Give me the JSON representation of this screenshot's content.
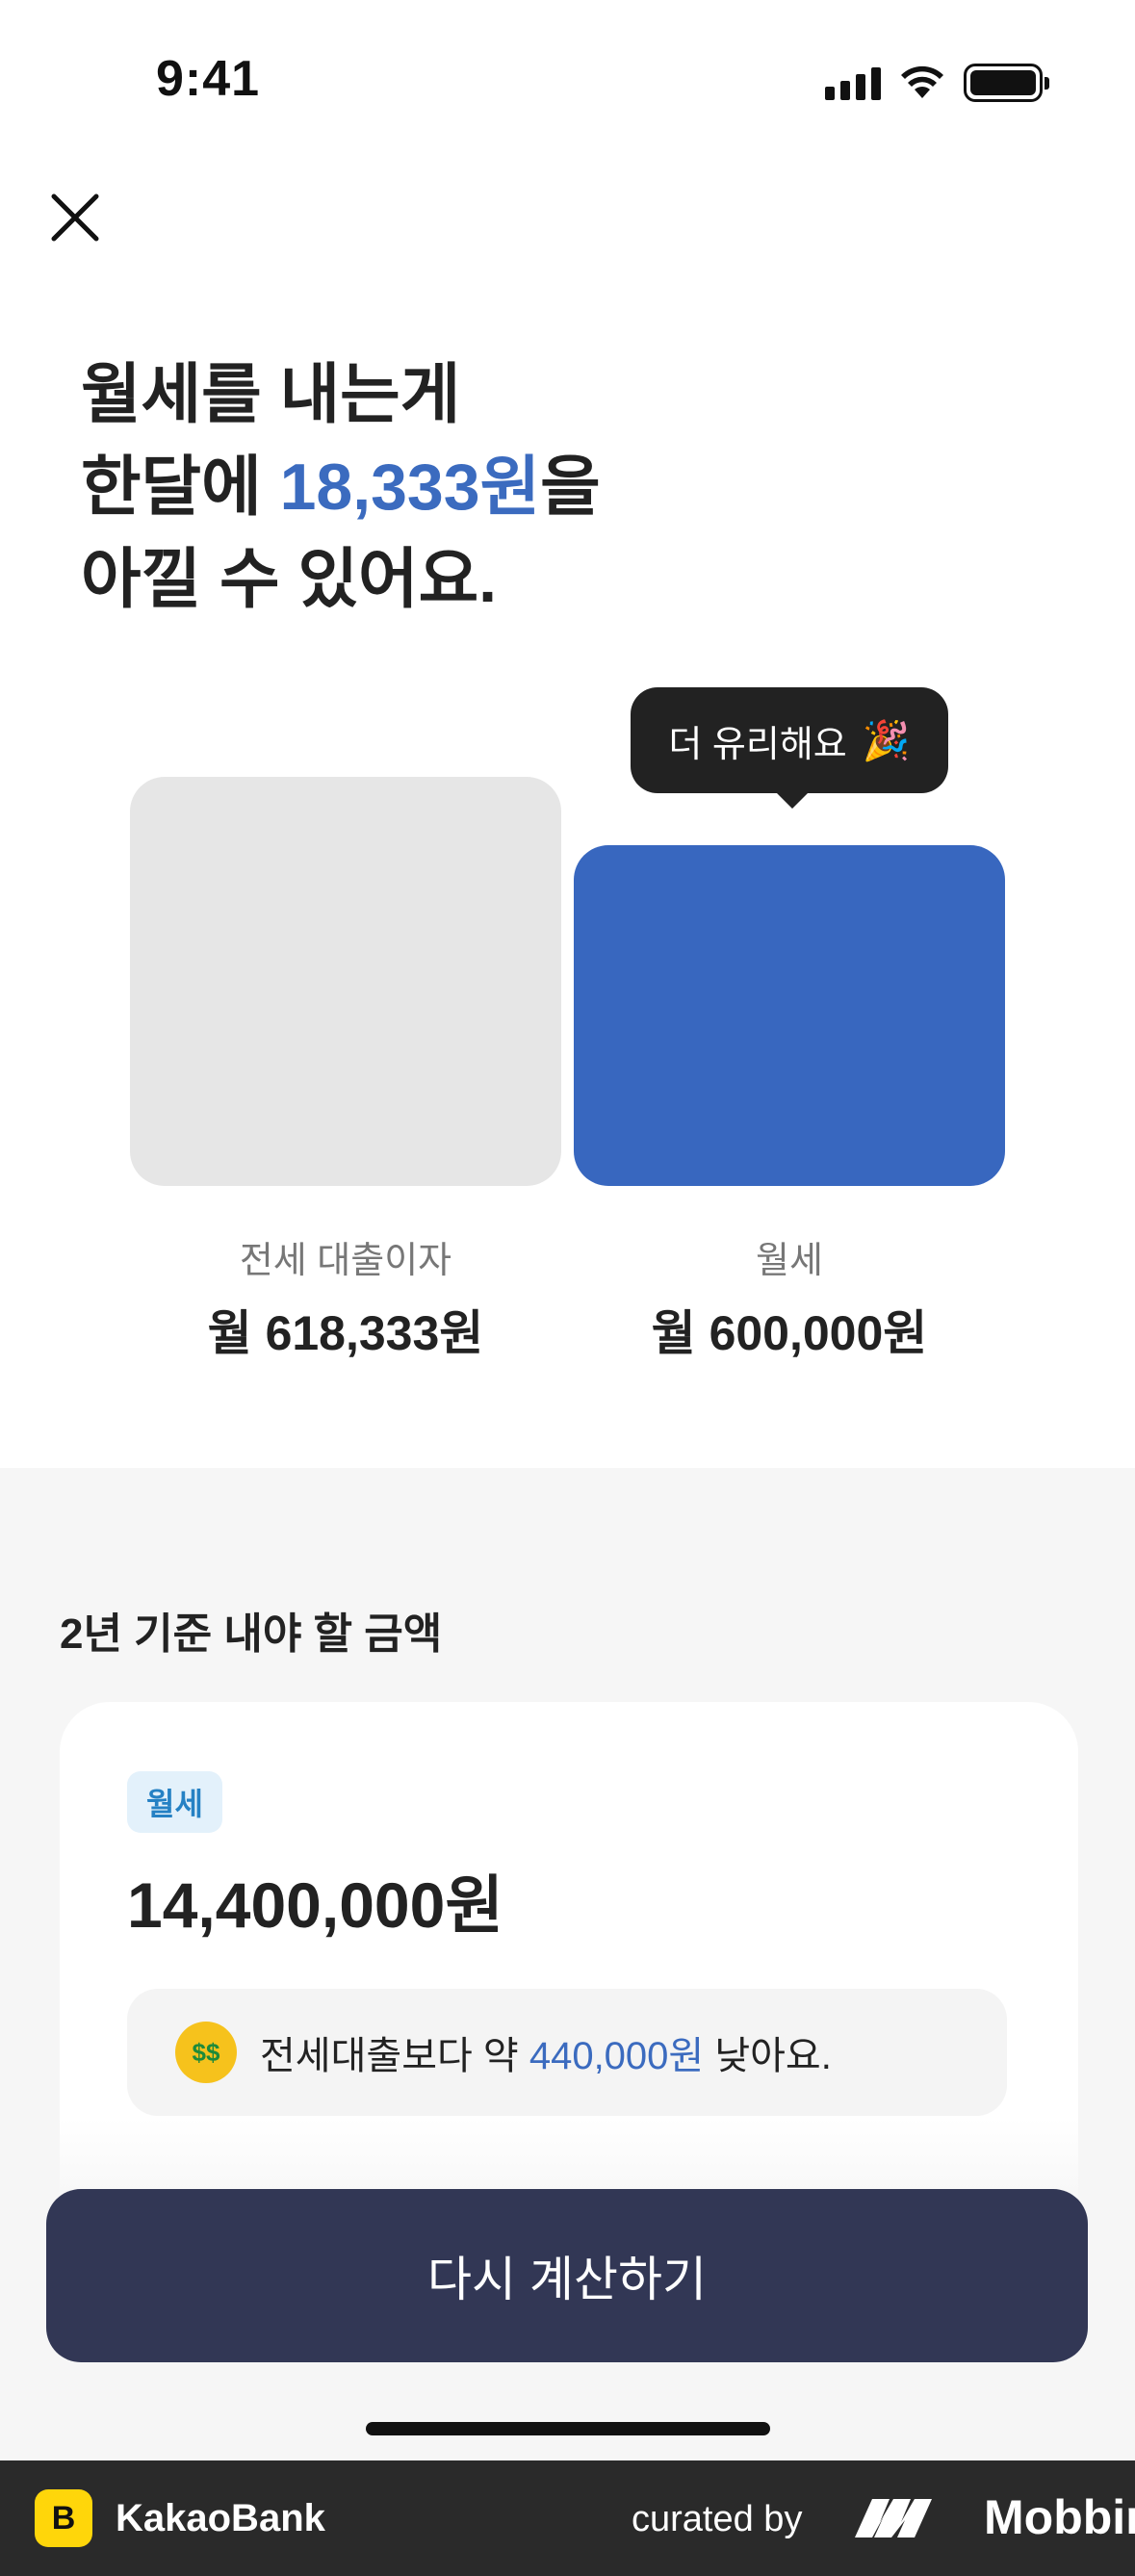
{
  "status_bar": {
    "time": "9:41"
  },
  "headline": {
    "line1": "월세를 내는게",
    "line2_prefix": "한달에 ",
    "amount": "18,333원",
    "line2_suffix": "을",
    "line3": "아낄 수 있어요."
  },
  "comparison": {
    "tooltip": "더 유리해요",
    "tooltip_icon": "party-popper-icon",
    "items": [
      {
        "label": "전세 대출이자",
        "value": "월 618,333원"
      },
      {
        "label": "월세",
        "value": "월 600,000원"
      }
    ],
    "colors": {
      "jeonse_bar": "#e6e6e6",
      "wolse_bar": "#3867bf"
    }
  },
  "summary": {
    "title": "2년 기준 내야 할 금액",
    "tag": "월세",
    "total": "14,400,000원",
    "note_prefix": "전세대출보다 약 ",
    "note_amount": "440,000원",
    "note_suffix": " 낮아요."
  },
  "cta": {
    "label": "다시 계산하기"
  },
  "footer": {
    "brand": "KakaoBank",
    "curated_by": "curated by",
    "mobbin": "Mobbin"
  },
  "colors": {
    "accent": "#3b6bbf",
    "cta_bg": "#323755"
  }
}
